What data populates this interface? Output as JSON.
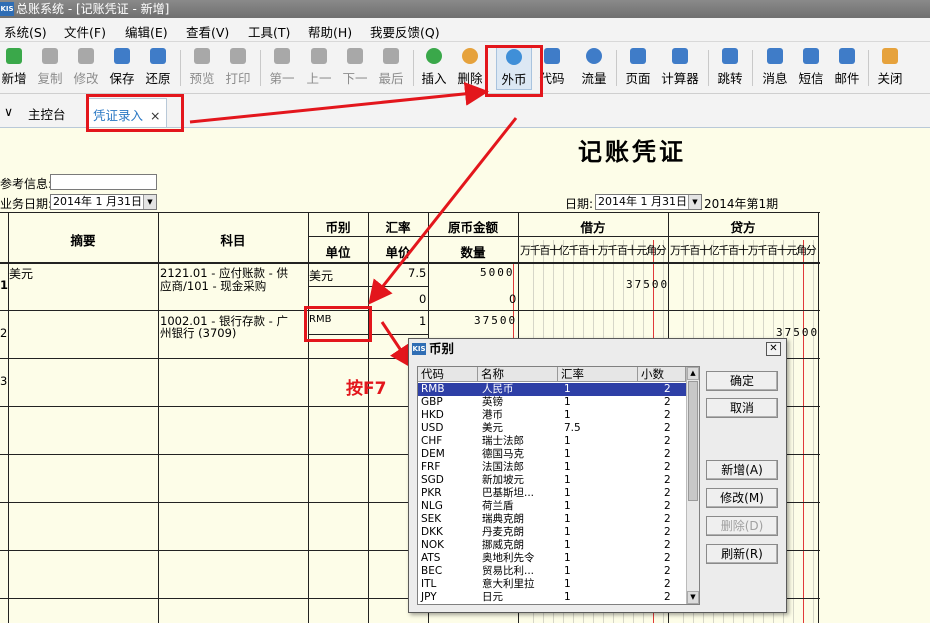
{
  "window": {
    "title": "总账系统 - [记账凭证 - 新增]",
    "logo": "KIS"
  },
  "menu": [
    "系统(S)",
    "文件(F)",
    "编辑(E)",
    "查看(V)",
    "工具(T)",
    "帮助(H)",
    "我要反馈(Q)"
  ],
  "toolbar": [
    {
      "label": "新增",
      "icon": "new-icon",
      "enabled": true,
      "color": "#3aa84a"
    },
    {
      "label": "复制",
      "icon": "copy-icon",
      "enabled": false
    },
    {
      "label": "修改",
      "icon": "edit-icon",
      "enabled": false
    },
    {
      "label": "保存",
      "icon": "save-icon",
      "enabled": true,
      "color": "#3f7cc8"
    },
    {
      "label": "还原",
      "icon": "undo-icon",
      "enabled": true,
      "color": "#3f7cc8"
    },
    {
      "label": "预览",
      "icon": "preview-icon",
      "enabled": false
    },
    {
      "label": "打印",
      "icon": "print-icon",
      "enabled": false
    },
    {
      "label": "第一",
      "icon": "first-icon",
      "enabled": false
    },
    {
      "label": "上一",
      "icon": "prev-icon",
      "enabled": false
    },
    {
      "label": "下一",
      "icon": "next-icon",
      "enabled": false
    },
    {
      "label": "最后",
      "icon": "last-icon",
      "enabled": false
    },
    {
      "label": "插入",
      "icon": "insert-icon",
      "enabled": true,
      "color": "#3aa84a"
    },
    {
      "label": "删除",
      "icon": "delete-icon",
      "enabled": true,
      "color": "#e6a23c"
    },
    {
      "label": "外币",
      "icon": "foreign-currency-icon",
      "enabled": true,
      "color": "#3f8fd8"
    },
    {
      "label": "代码",
      "icon": "code-icon",
      "enabled": true,
      "color": "#3f7cc8"
    },
    {
      "label": "流量",
      "icon": "cashflow-icon",
      "enabled": true,
      "color": "#3f7cc8"
    },
    {
      "label": "页面",
      "icon": "page-icon",
      "enabled": true,
      "color": "#3f7cc8"
    },
    {
      "label": "计算器",
      "icon": "calculator-icon",
      "enabled": true,
      "color": "#3f7cc8"
    },
    {
      "label": "跳转",
      "icon": "jump-icon",
      "enabled": true,
      "color": "#3f7cc8"
    },
    {
      "label": "消息",
      "icon": "message-icon",
      "enabled": true,
      "color": "#3f7cc8"
    },
    {
      "label": "短信",
      "icon": "sms-icon",
      "enabled": true,
      "color": "#3f7cc8"
    },
    {
      "label": "邮件",
      "icon": "mail-icon",
      "enabled": true,
      "color": "#3f7cc8"
    },
    {
      "label": "关闭",
      "icon": "close-door-icon",
      "enabled": true,
      "color": "#e6a23c"
    }
  ],
  "tabs": {
    "home": "主控台",
    "voucher": "凭证录入",
    "close": "×",
    "arrow": "∨"
  },
  "voucher": {
    "title": "记账凭证",
    "ref_label": "参考信息:",
    "ref_value": "",
    "biz_date_label": "业务日期:",
    "biz_date": "2014年 1 月31日",
    "date_label": "日期:",
    "date": "2014年 1 月31日",
    "period": "2014年第1期",
    "headers": {
      "summary": "摘要",
      "account": "科目",
      "currency": "币别",
      "unit": "单位",
      "rate": "汇率",
      "unit_price": "单价",
      "orig_amount": "原币金额",
      "qty": "数量",
      "debit": "借方",
      "credit": "贷方",
      "digit_units": "万千百十亿千百十万千百十元角分"
    },
    "rows": [
      {
        "no": "1",
        "summary": "美元",
        "account_line1": "2121.01 - 应付账款 - 供",
        "account_line2": "应商/101 - 现金采购",
        "currency": "美元",
        "rate": "7.5",
        "orig": "5000",
        "qty_rate": "0",
        "qty": "0",
        "debit": "37500",
        "credit": ""
      },
      {
        "no": "2",
        "summary": "",
        "account_line1": "1002.01 - 银行存款 - 广",
        "account_line2": "州银行 (3709)",
        "currency": "RMB",
        "rate": "1",
        "orig": "37500",
        "debit": "",
        "credit": "37500"
      },
      {
        "no": "3",
        "summary": "",
        "account_line1": "",
        "account_line2": "",
        "currency": "",
        "rate": "",
        "orig": "",
        "debit": "",
        "credit": ""
      }
    ]
  },
  "annotation": {
    "hint": "按F7"
  },
  "dialog": {
    "title": "币别",
    "logo": "KIS",
    "close": "✕",
    "columns": [
      "代码",
      "名称",
      "汇率",
      "小数"
    ],
    "rows": [
      [
        "RMB",
        "人民币",
        "1",
        "2"
      ],
      [
        "GBP",
        "英镑",
        "1",
        "2"
      ],
      [
        "HKD",
        "港币",
        "1",
        "2"
      ],
      [
        "USD",
        "美元",
        "7.5",
        "2"
      ],
      [
        "CHF",
        "瑞士法郎",
        "1",
        "2"
      ],
      [
        "DEM",
        "德国马克",
        "1",
        "2"
      ],
      [
        "FRF",
        "法国法郎",
        "1",
        "2"
      ],
      [
        "SGD",
        "新加坡元",
        "1",
        "2"
      ],
      [
        "PKR",
        "巴基斯坦...",
        "1",
        "2"
      ],
      [
        "NLG",
        "荷兰盾",
        "1",
        "2"
      ],
      [
        "SEK",
        "瑞典克朗",
        "1",
        "2"
      ],
      [
        "DKK",
        "丹麦克朗",
        "1",
        "2"
      ],
      [
        "NOK",
        "挪威克朗",
        "1",
        "2"
      ],
      [
        "ATS",
        "奥地利先令",
        "1",
        "2"
      ],
      [
        "BEC",
        "贸易比利...",
        "1",
        "2"
      ],
      [
        "ITL",
        "意大利里拉",
        "1",
        "2"
      ],
      [
        "JPY",
        "日元",
        "1",
        "2"
      ]
    ],
    "buttons": {
      "ok": "确定",
      "cancel": "取消",
      "add": "新增(A)",
      "modify": "修改(M)",
      "delete": "删除(D)",
      "refresh": "刷新(R)"
    }
  },
  "colors": {
    "highlight": "#e3161c",
    "selection": "#2e3fa6",
    "paper": "#fdfde8"
  }
}
